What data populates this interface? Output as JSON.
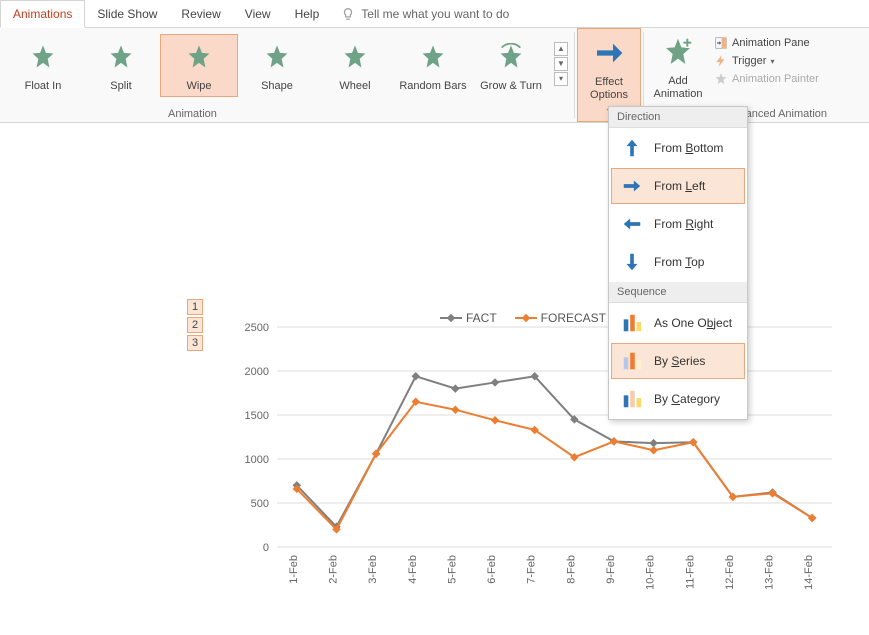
{
  "tabs": {
    "animations": "Animations",
    "slide_show": "Slide Show",
    "review": "Review",
    "view": "View",
    "help": "Help",
    "tell_me": "Tell me what you want to do"
  },
  "anim_gallery": {
    "float_in": "Float In",
    "split": "Split",
    "wipe": "Wipe",
    "shape": "Shape",
    "wheel": "Wheel",
    "random_bars": "Random Bars",
    "grow_turn": "Grow & Turn"
  },
  "group_anim": "Animation",
  "group_adv": "Advanced Animation",
  "effect_options": "Effect\nOptions",
  "add_animation": "Add\nAnimation",
  "adv": {
    "pane": "Animation Pane",
    "trigger": "Trigger",
    "painter": "Animation Painter"
  },
  "dropdown": {
    "direction": "Direction",
    "from_bottom": "From Bottom",
    "from_left": "From Left",
    "from_right": "From Right",
    "from_top": "From Top",
    "sequence": "Sequence",
    "as_one": "As One Object",
    "by_series": "By Series",
    "by_category": "By Category"
  },
  "anim_tags": [
    "1",
    "2",
    "3"
  ],
  "legend": {
    "fact": "FACT",
    "forecast": "FORECAST"
  },
  "chart_data": {
    "type": "line",
    "categories": [
      "1-Feb",
      "2-Feb",
      "3-Feb",
      "4-Feb",
      "5-Feb",
      "6-Feb",
      "7-Feb",
      "8-Feb",
      "9-Feb",
      "10-Feb",
      "11-Feb",
      "12-Feb",
      "13-Feb",
      "14-Feb"
    ],
    "series": [
      {
        "name": "FACT",
        "values": [
          700,
          230,
          1060,
          1940,
          1800,
          1870,
          1940,
          1450,
          1200,
          1180,
          1190,
          570,
          620,
          330
        ],
        "color": "#7f7f7f"
      },
      {
        "name": "FORECAST",
        "values": [
          660,
          200,
          1060,
          1650,
          1560,
          1440,
          1330,
          1020,
          1200,
          1100,
          1190,
          570,
          610,
          330
        ],
        "color": "#ed7d31"
      }
    ],
    "ylim": [
      0,
      2500
    ],
    "yticks": [
      0,
      500,
      1000,
      1500,
      2000,
      2500
    ]
  }
}
